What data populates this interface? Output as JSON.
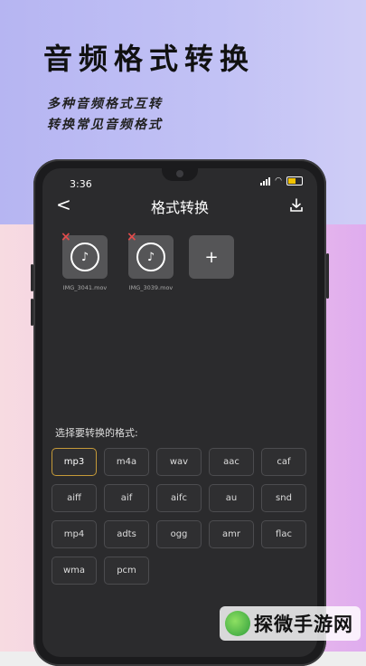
{
  "hero": {
    "title": "音频格式转换",
    "subtitle_line1": "多种音频格式互转",
    "subtitle_line2": "转换常见音频格式"
  },
  "status": {
    "time": "3:36"
  },
  "nav": {
    "back": "<",
    "title": "格式转换"
  },
  "files": [
    {
      "name": "IMG_3041.mov",
      "delete": "×"
    },
    {
      "name": "IMG_3039.mov",
      "delete": "×"
    }
  ],
  "add_label": "+",
  "format_label": "选择要转换的格式:",
  "formats": [
    "mp3",
    "m4a",
    "wav",
    "aac",
    "caf",
    "aiff",
    "aif",
    "aifc",
    "au",
    "snd",
    "mp4",
    "adts",
    "ogg",
    "amr",
    "flac",
    "wma",
    "pcm"
  ],
  "selected_format": "mp3",
  "watermark": "探微手游网",
  "colors": {
    "accent": "#c59a39",
    "screen_bg": "#2b2b2d",
    "delete": "#e34b4b"
  }
}
